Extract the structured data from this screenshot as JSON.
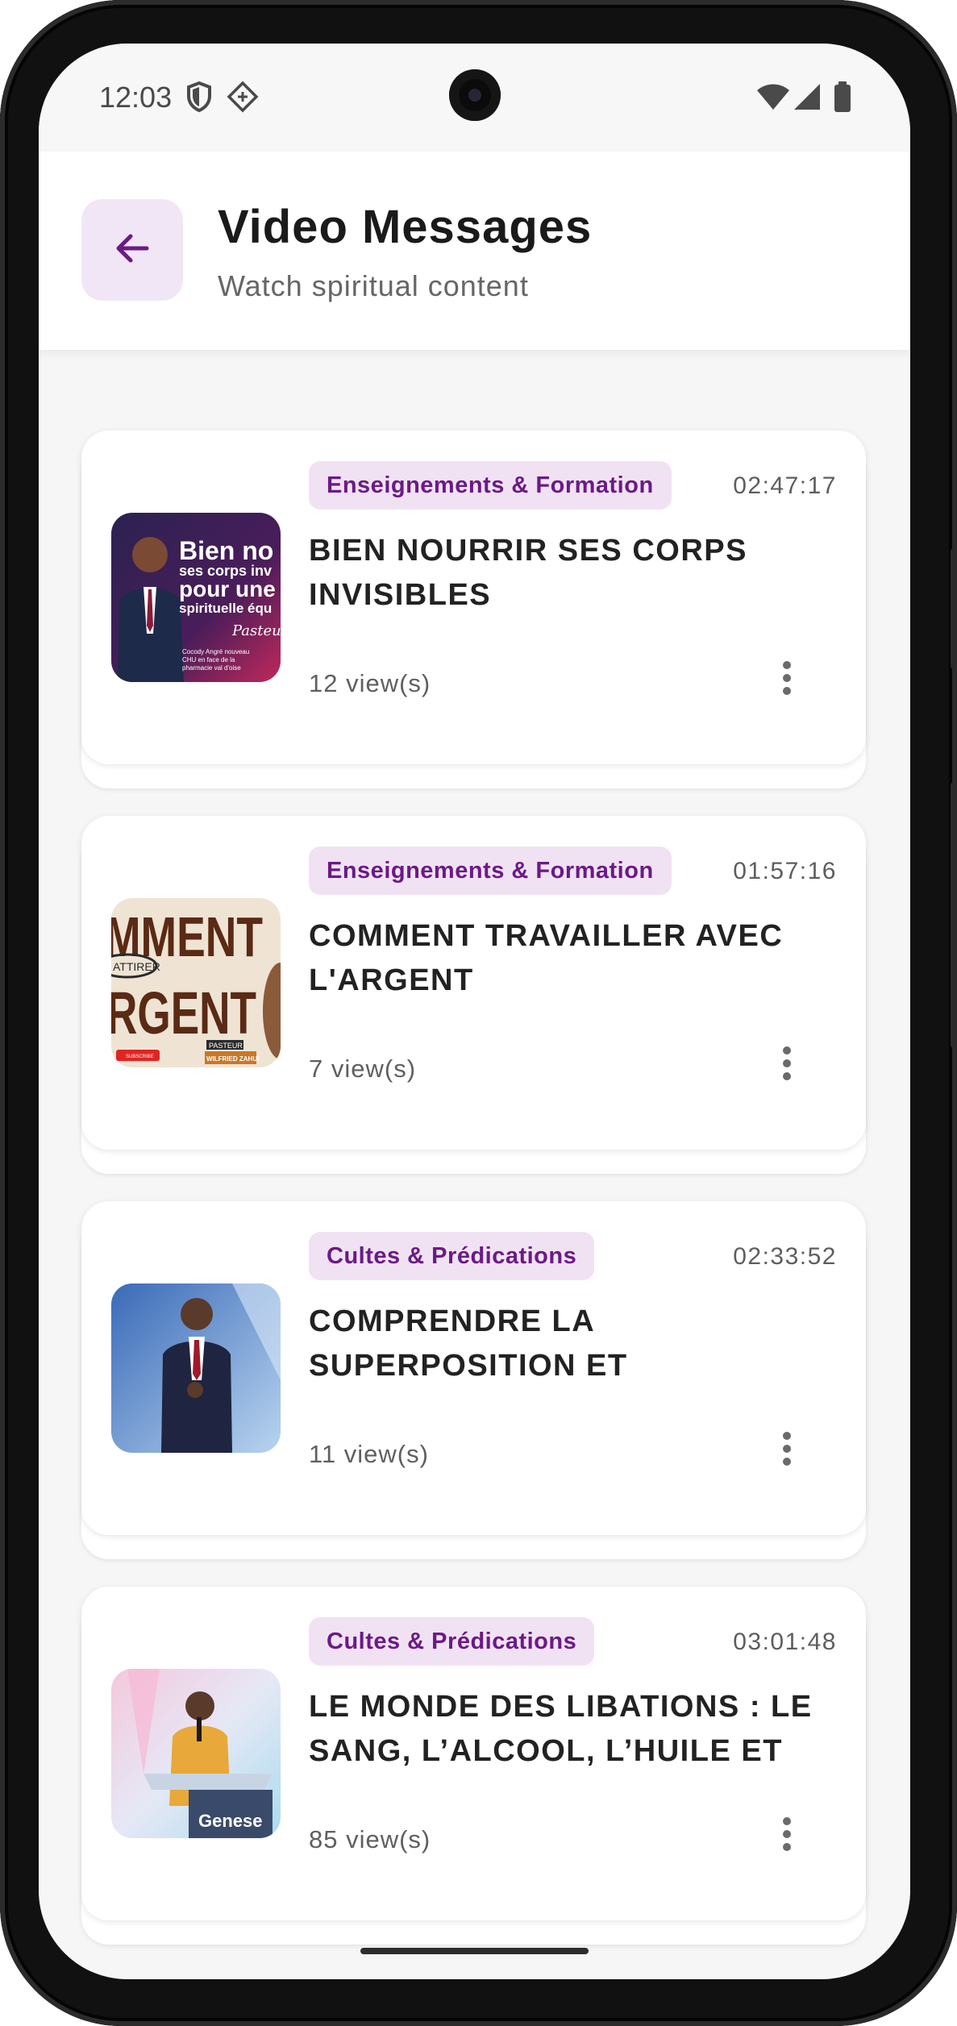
{
  "status_bar": {
    "time": "12:03",
    "icons": [
      "shield-icon",
      "diamond-signal-icon",
      "wifi-icon",
      "cellular-icon",
      "battery-icon"
    ]
  },
  "header": {
    "title": "Video Messages",
    "subtitle": "Watch spiritual content",
    "back_icon": "arrow-left-icon"
  },
  "colors": {
    "accent": "#6b1a86",
    "chip_bg": "#f1e2f3",
    "back_bg": "#f1e6f5"
  },
  "videos": [
    {
      "category": "Enseignements & Formation",
      "duration": "02:47:17",
      "title": "BIEN NOURRIR SES CORPS INVISIBLES",
      "views": "12 view(s)",
      "thumbnail": {
        "lines": [
          "Bien no",
          "ses corps inv",
          "pour une",
          "spirituelle équ"
        ],
        "signature": "Pasteur",
        "caption": "Cocody Angré nouveau CHU en face de la pharmacie val d'oise"
      }
    },
    {
      "category": "Enseignements & Formation",
      "duration": "01:57:16",
      "title": "COMMENT TRAVAILLER AVEC L'ARGENT",
      "views": "7 view(s)",
      "thumbnail": {
        "lines": [
          "MMENT",
          "ATTIRER",
          "RGENT"
        ],
        "tag": "PASTEUR",
        "name": "WILFRIED ZAHUI",
        "button": "SUBSCRIBE"
      }
    },
    {
      "category": "Cultes & Prédications",
      "duration": "02:33:52",
      "title": "COMPRENDRE LA SUPERPOSITION ET",
      "views": "11 view(s)",
      "thumbnail": {}
    },
    {
      "category": "Cultes & Prédications",
      "duration": "03:01:48",
      "title": "LE MONDE DES LIBATIONS : LE SANG, L’ALCOOL, L’HUILE ET",
      "views": "85 view(s)",
      "thumbnail": {
        "podium": "Genese"
      }
    }
  ]
}
